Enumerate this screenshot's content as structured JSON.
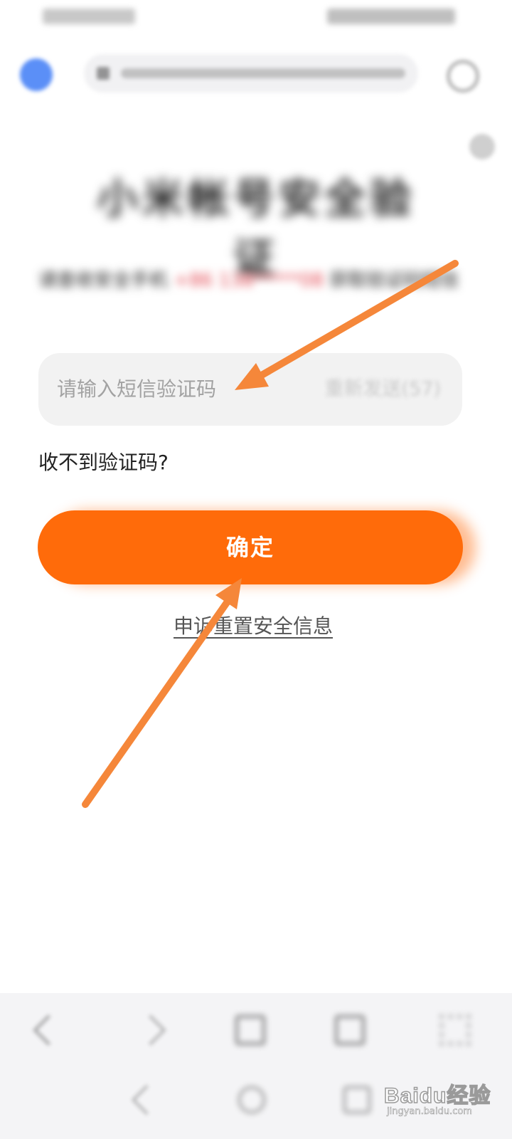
{
  "page": {
    "title": "小米帐号安全验证",
    "description_prefix": "请查收安全手机",
    "description_phone": "+86 138*****08",
    "description_suffix": "获取验证码短信"
  },
  "form": {
    "code_placeholder": "请输入短信验证码",
    "resend_label": "重新发送(57)",
    "no_code_label": "收不到验证码?",
    "confirm_label": "确定",
    "appeal_label": "申诉重置安全信息"
  },
  "colors": {
    "accent": "#ff6b0a",
    "arrow": "#f5873a",
    "phone": "#e2454f"
  },
  "icons": {
    "browser": "browser-logo-icon",
    "refresh": "refresh-icon",
    "help": "help-icon",
    "toolbar": [
      "back-icon",
      "forward-icon",
      "home-icon",
      "tabs-icon",
      "menu-icon"
    ],
    "system_nav": [
      "nav-back-icon",
      "nav-home-icon",
      "nav-recent-icon"
    ]
  },
  "watermark": {
    "logo": "Baidu经验",
    "url": "jingyan.baidu.com"
  }
}
